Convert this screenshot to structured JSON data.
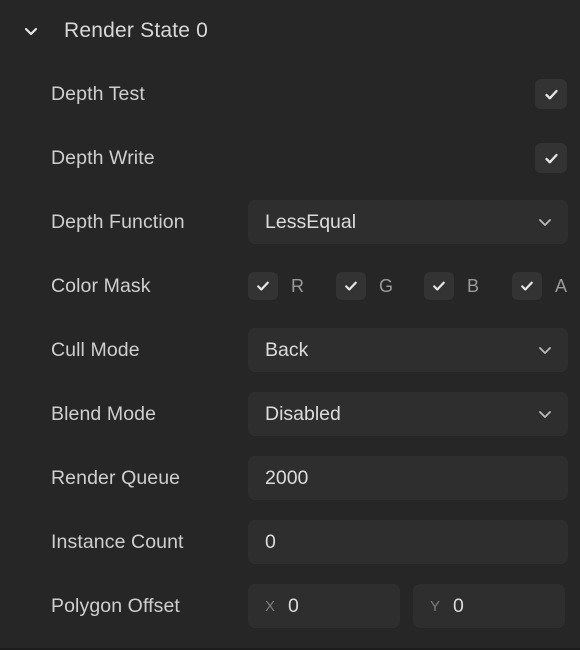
{
  "section": {
    "title": "Render State 0",
    "expanded": true,
    "toggle_icon": "chevron-down-icon"
  },
  "theme": {
    "panel_bg": "#262626",
    "field_bg": "#2e2e2e",
    "checkbox_bg": "#333333",
    "label_color": "#cfcfcf",
    "value_color": "#dcdcdc",
    "muted_color": "#9a9a9a"
  },
  "rows": [
    {
      "label": "Depth Test",
      "type": "checkbox",
      "checked": true
    },
    {
      "label": "Depth Write",
      "type": "checkbox",
      "checked": true
    },
    {
      "label": "Depth Function",
      "type": "select",
      "value": "LessEqual",
      "chevron": "chevron-down-icon"
    },
    {
      "label": "Color Mask",
      "type": "mask",
      "channels": [
        {
          "label": "R",
          "checked": true
        },
        {
          "label": "G",
          "checked": true
        },
        {
          "label": "B",
          "checked": true
        },
        {
          "label": "A",
          "checked": true
        }
      ]
    },
    {
      "label": "Cull Mode",
      "type": "select",
      "value": "Back",
      "chevron": "chevron-down-icon"
    },
    {
      "label": "Blend Mode",
      "type": "select",
      "value": "Disabled",
      "chevron": "chevron-down-icon"
    },
    {
      "label": "Render Queue",
      "type": "field",
      "value": "2000"
    },
    {
      "label": "Instance Count",
      "type": "field",
      "value": "0"
    },
    {
      "label": "Polygon Offset",
      "type": "vector",
      "components": [
        {
          "axis": "X",
          "value": "0"
        },
        {
          "axis": "Y",
          "value": "0"
        }
      ]
    }
  ]
}
